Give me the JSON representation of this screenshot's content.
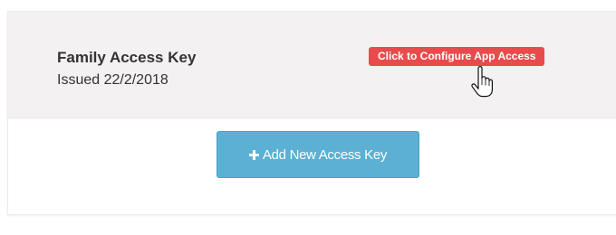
{
  "access_key": {
    "title": "Family Access Key",
    "issued": "Issued 22/2/2018",
    "configure_label": "Click to Configure App Access"
  },
  "actions": {
    "add_label": "Add New Access Key",
    "add_icon": "plus-icon"
  },
  "colors": {
    "configure_badge": "#e84b4b",
    "add_button": "#5bb0d4",
    "row_background": "#f3f1f1"
  }
}
